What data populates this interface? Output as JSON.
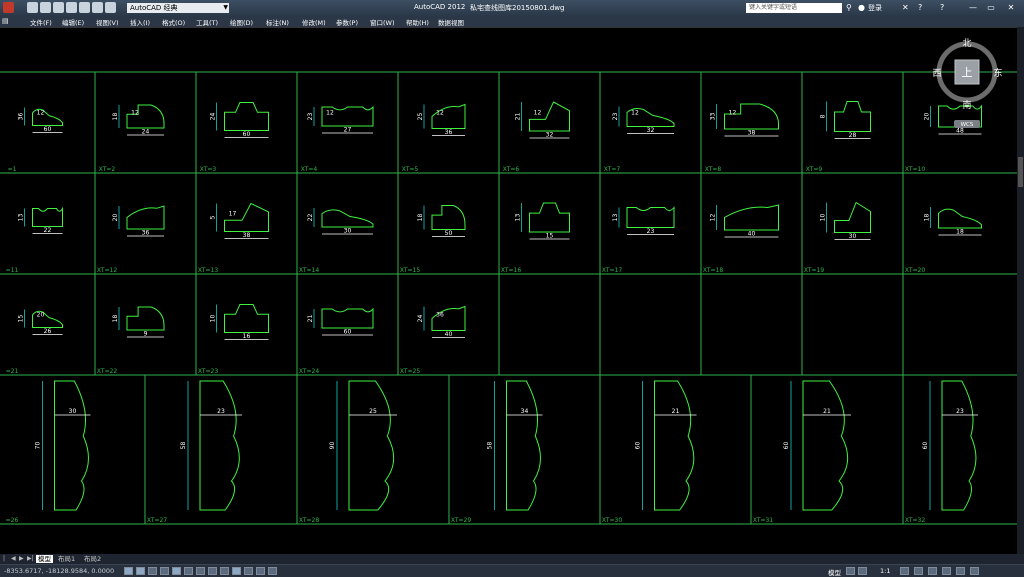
{
  "app": {
    "workspace": "AutoCAD 经典",
    "app_name": "AutoCAD 2012",
    "filename": "私宅查线图库20150801.dwg",
    "search_placeholder": "键入关键字或短语",
    "login_label": "登录"
  },
  "menu": [
    "文件(F)",
    "编辑(E)",
    "视图(V)",
    "插入(I)",
    "格式(O)",
    "工具(T)",
    "绘图(D)",
    "标注(N)",
    "修改(M)",
    "参数(P)",
    "窗口(W)",
    "帮助(H)",
    "数据视图"
  ],
  "viewcube": {
    "north": "北",
    "south": "南",
    "east": "东",
    "west": "西",
    "top": "上",
    "wcs": "WCS"
  },
  "drawing": {
    "rows": [
      [
        {
          "id": "=1",
          "dims": [
            "60",
            "36",
            "12"
          ]
        },
        {
          "id": "XT=2",
          "dims": [
            "24",
            "18",
            "12"
          ]
        },
        {
          "id": "XT=3",
          "dims": [
            "60",
            "24"
          ]
        },
        {
          "id": "XT=4",
          "dims": [
            "27",
            "23",
            "12"
          ]
        },
        {
          "id": "XT=5",
          "dims": [
            "36",
            "25",
            "12"
          ]
        },
        {
          "id": "XT=6",
          "dims": [
            "32",
            "21",
            "12"
          ]
        },
        {
          "id": "XT=7",
          "dims": [
            "32",
            "23",
            "12"
          ]
        },
        {
          "id": "XT=8",
          "dims": [
            "38",
            "33",
            "12"
          ]
        },
        {
          "id": "XT=9",
          "dims": [
            "28",
            "8"
          ]
        },
        {
          "id": "XT=10",
          "dims": [
            "48",
            "20"
          ]
        }
      ],
      [
        {
          "id": "=11",
          "dims": [
            "22",
            "13"
          ]
        },
        {
          "id": "XT=12",
          "dims": [
            "36",
            "20"
          ]
        },
        {
          "id": "XT=13",
          "dims": [
            "38",
            "5",
            "17"
          ]
        },
        {
          "id": "XT=14",
          "dims": [
            "30",
            "22"
          ]
        },
        {
          "id": "XT=15",
          "dims": [
            "50",
            "18"
          ]
        },
        {
          "id": "XT=16",
          "dims": [
            "15",
            "13"
          ]
        },
        {
          "id": "XT=17",
          "dims": [
            "23",
            "13"
          ]
        },
        {
          "id": "XT=18",
          "dims": [
            "40",
            "12"
          ]
        },
        {
          "id": "XT=19",
          "dims": [
            "30",
            "10"
          ]
        },
        {
          "id": "XT=20",
          "dims": [
            "18",
            "18"
          ]
        }
      ],
      [
        {
          "id": "=21",
          "dims": [
            "26",
            "15",
            "20"
          ]
        },
        {
          "id": "XT=22",
          "dims": [
            "9",
            "18"
          ]
        },
        {
          "id": "XT=23",
          "dims": [
            "16",
            "10"
          ]
        },
        {
          "id": "XT=24",
          "dims": [
            "60",
            "21"
          ]
        },
        {
          "id": "XT=25",
          "dims": [
            "40",
            "24",
            "36"
          ]
        },
        {
          "id": "",
          "dims": []
        },
        {
          "id": "",
          "dims": []
        },
        {
          "id": "",
          "dims": []
        },
        {
          "id": "",
          "dims": []
        },
        {
          "id": "",
          "dims": []
        }
      ]
    ],
    "bottom_row": [
      {
        "id": "=26",
        "dims": [
          "30",
          "70"
        ]
      },
      {
        "id": "XT=27",
        "dims": [
          "23",
          "58"
        ]
      },
      {
        "id": "XT=28",
        "dims": [
          "25",
          "90"
        ]
      },
      {
        "id": "XT=29",
        "dims": [
          "34",
          "58"
        ]
      },
      {
        "id": "XT=30",
        "dims": [
          "21",
          "60"
        ]
      },
      {
        "id": "XT=31",
        "dims": [
          "21",
          "60"
        ]
      },
      {
        "id": "XT=32",
        "dims": [
          "23",
          "60"
        ]
      }
    ]
  },
  "tabs": [
    "模型",
    "布局1",
    "布局2"
  ],
  "status": {
    "coordinates": "-8353.6717, -18128.9584, 0.0000",
    "model_label": "模型",
    "scale_label": "1:1"
  },
  "colors": {
    "background": "#000000",
    "grid_line": "#2fb34a",
    "profile": "#3ef23e",
    "dimension": "#ffffff",
    "extension_line": "#19c7c7"
  }
}
